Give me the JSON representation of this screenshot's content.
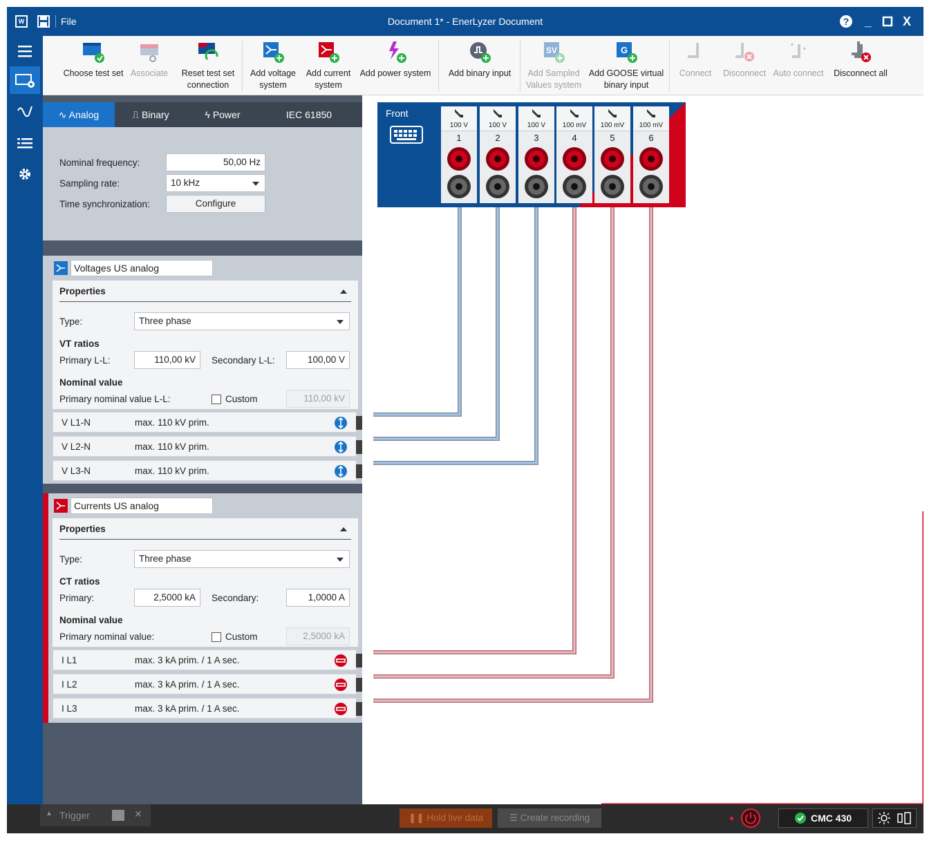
{
  "titlebar": {
    "app_logo": "W",
    "file_menu": "File",
    "title": "Document 1* - EnerLyzer Document",
    "help_icon": "help-icon",
    "minimize": "_",
    "maximize": "□",
    "close": "X"
  },
  "nav": [
    "menu-icon",
    "hardware-config-icon",
    "signal-icon",
    "list-icon",
    "settings-icon"
  ],
  "ribbon": {
    "choose_test_set": "Choose test set",
    "associate": "Associate",
    "reset_line1": "Reset test set",
    "reset_line2": "connection",
    "add_voltage_1": "Add voltage",
    "add_voltage_2": "system",
    "add_current_1": "Add current",
    "add_current_2": "system",
    "add_power": "Add power system",
    "add_binary": "Add binary input",
    "add_sv_1": "Add Sampled",
    "add_sv_2": "Values system",
    "add_goose_1": "Add GOOSE virtual",
    "add_goose_2": "binary input",
    "connect": "Connect",
    "disconnect": "Disconnect",
    "auto_connect": "Auto connect",
    "disconnect_all": "Disconnect all",
    "sv_glyph": "SV",
    "goose_glyph": "G"
  },
  "tabs": {
    "analog": "Analog",
    "binary": "Binary",
    "power": "Power",
    "iec": "IEC 61850"
  },
  "general": {
    "nominal_frequency_label": "Nominal frequency:",
    "nominal_frequency_value": "50,00 Hz",
    "sampling_rate_label": "Sampling rate:",
    "sampling_rate_value": "10 kHz",
    "time_sync_label": "Time synchronization:",
    "configure": "Configure"
  },
  "voltages": {
    "name": "Voltages US analog",
    "properties": "Properties",
    "type_label": "Type:",
    "type_value": "Three phase",
    "vt_ratios": "VT ratios",
    "primary_label": "Primary L-L:",
    "primary_value": "110,00 kV",
    "secondary_label": "Secondary L-L:",
    "secondary_value": "100,00 V",
    "nominal_value": "Nominal value",
    "primary_nominal_label": "Primary nominal value L-L:",
    "custom": "Custom",
    "primary_nominal_value": "110,00 kV",
    "channels": [
      {
        "name": "V L1-N",
        "desc": "max. 110 kV prim."
      },
      {
        "name": "V L2-N",
        "desc": "max. 110 kV prim."
      },
      {
        "name": "V L3-N",
        "desc": "max. 110 kV prim."
      }
    ]
  },
  "currents": {
    "name": "Currents US analog",
    "properties": "Properties",
    "type_label": "Type:",
    "type_value": "Three phase",
    "ct_ratios": "CT ratios",
    "primary_label": "Primary:",
    "primary_value": "2,5000 kA",
    "secondary_label": "Secondary:",
    "secondary_value": "1,0000 A",
    "nominal_value": "Nominal value",
    "primary_nominal_label": "Primary nominal value:",
    "custom": "Custom",
    "primary_nominal_value": "2,5000 kA",
    "channels": [
      {
        "name": "I L1",
        "desc": "max. 3 kA prim. / 1 A sec."
      },
      {
        "name": "I L2",
        "desc": "max. 3 kA prim. / 1 A sec."
      },
      {
        "name": "I L3",
        "desc": "max. 3 kA prim. / 1 A sec."
      }
    ]
  },
  "device": {
    "label": "Front",
    "slots": [
      {
        "range": "100 V",
        "num": "1"
      },
      {
        "range": "100 V",
        "num": "2"
      },
      {
        "range": "100 V",
        "num": "3"
      },
      {
        "range": "100 mV",
        "num": "4"
      },
      {
        "range": "100 mV",
        "num": "5"
      },
      {
        "range": "100 mV",
        "num": "6"
      }
    ]
  },
  "statusbar": {
    "trigger": "Trigger",
    "hold_live_data": "Hold live data",
    "create_recording": "Create recording",
    "device_name": "CMC 430"
  },
  "colors": {
    "primary_blue": "#0c4e94",
    "accent_blue": "#1b73c9",
    "accent_red": "#d0021b",
    "voltage_wire": "#8fb2d6",
    "current_wire": "#d9a0a8"
  }
}
